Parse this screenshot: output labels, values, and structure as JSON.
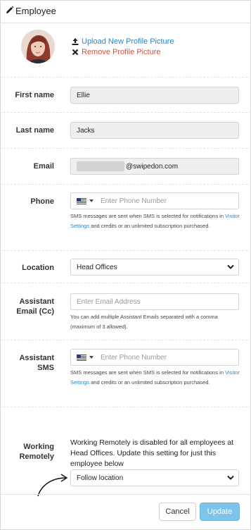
{
  "header": {
    "title": "Employee",
    "icon": "pencil-icon"
  },
  "profile": {
    "upload_label": "Upload New Profile Picture",
    "remove_label": "Remove Profile Picture",
    "upload_color": "#2a86c8",
    "remove_color": "#e24a3b"
  },
  "fields": {
    "first_name": {
      "label": "First name",
      "value": "Ellie"
    },
    "last_name": {
      "label": "Last name",
      "value": "Jacks"
    },
    "email": {
      "label": "Email",
      "value_suffix": "@swipedon.com"
    },
    "phone": {
      "label": "Phone",
      "placeholder": "Enter Phone Number",
      "help_prefix": "SMS messages are sent when SMS is selected for notifications in",
      "help_link": "Visitor Settings",
      "help_suffix": "and credits or an unlimited subscription purchased."
    },
    "location": {
      "label": "Location",
      "value": "Head Offices"
    },
    "assistant_email": {
      "label": "Assistant Email (Cc)",
      "placeholder": "Enter Email Address",
      "help": "You can add multiple Assistant Emails separated with a comma (maximum of 3 allowed)."
    },
    "assistant_sms": {
      "label": "Assistant SMS",
      "placeholder": "Enter Phone Number",
      "help_prefix": "SMS messages are sent when SMS is selected for notifications in",
      "help_link": "Visitor Settings",
      "help_suffix": "and credits or an unlimited subscription purchased."
    },
    "working_remotely": {
      "label": "Working Remotely",
      "message": "Working Remotely is disabled for all employees at Head Offices. Update this setting for just this employee below",
      "value": "Follow location"
    }
  },
  "footer": {
    "cancel_label": "Cancel",
    "update_label": "Update",
    "update_color": "#7fc2ea"
  }
}
